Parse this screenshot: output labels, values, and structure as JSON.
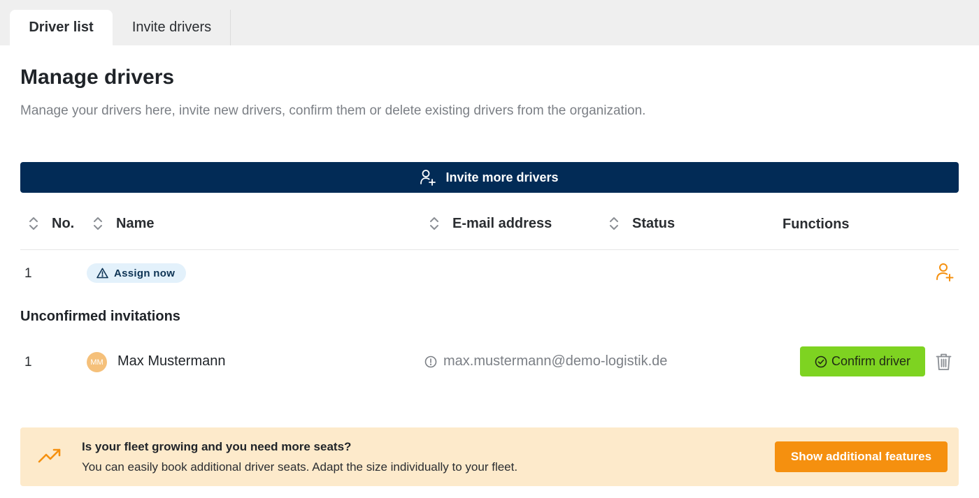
{
  "tabs": [
    {
      "label": "Driver list",
      "active": true
    },
    {
      "label": "Invite drivers",
      "active": false
    }
  ],
  "page": {
    "title": "Manage drivers",
    "description": "Manage your drivers here, invite new drivers, confirm them or delete existing drivers from the organization."
  },
  "invite_button": {
    "label": "Invite more drivers",
    "icon": "user-plus-icon"
  },
  "table": {
    "columns": [
      {
        "label": "No.",
        "sortable": true
      },
      {
        "label": "Name",
        "sortable": true
      },
      {
        "label": "E-mail address",
        "sortable": true
      },
      {
        "label": "Status",
        "sortable": true
      },
      {
        "label": "Functions",
        "sortable": false
      }
    ],
    "rows": [
      {
        "no": "1",
        "badge": "Assign now",
        "badge_icon": "warning-triangle-icon",
        "action_icon": "user-plus-icon"
      }
    ]
  },
  "unconfirmed": {
    "title": "Unconfirmed invitations",
    "rows": [
      {
        "no": "1",
        "initials": "MM",
        "name": "Max Mustermann",
        "email": "max.mustermann@demo-logistik.de",
        "email_icon": "info-circle-icon",
        "confirm_label": "Confirm driver",
        "delete_icon": "trash-icon"
      }
    ]
  },
  "promo": {
    "icon": "trending-up-icon",
    "title": "Is your fleet growing and you need more seats?",
    "text": "You can easily book additional driver seats. Adapt the size individually to your fleet.",
    "button_label": "Show additional features"
  },
  "colors": {
    "navy": "#022b56",
    "green": "#7ed321",
    "orange": "#f5900f",
    "promo_bg": "#fdeacb",
    "badge_bg": "#e3f1fb",
    "avatar": "#f5c07a"
  }
}
